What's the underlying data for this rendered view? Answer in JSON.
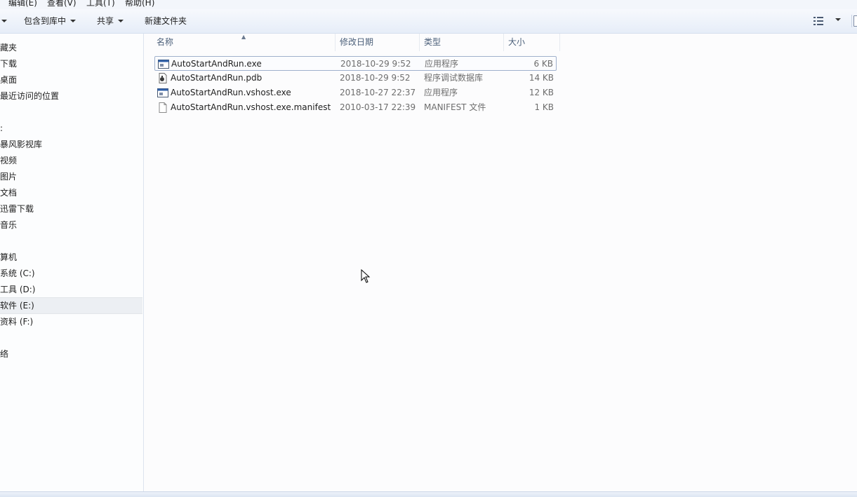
{
  "menu": {
    "edit": "编辑(E)",
    "view": "查看(V)",
    "tools": "工具(T)",
    "help": "帮助(H)"
  },
  "toolbar": {
    "include_in_library": "包含到库中",
    "share": "共享",
    "new_folder": "新建文件夹"
  },
  "nav": {
    "items": [
      "藏夹",
      "下载",
      "桌面",
      "最近访问的位置",
      "",
      "暴风影视库",
      "视频",
      "图片",
      "文档",
      "迅雷下载",
      "音乐",
      "算机",
      "系统 (C:)",
      "工具 (D:)",
      "软件 (E:)",
      "资料 (F:)",
      "络"
    ],
    "selected": "软件 (E:)"
  },
  "columns": {
    "name": "名称",
    "date": "修改日期",
    "type": "类型",
    "size": "大小"
  },
  "files": [
    {
      "name": "AutoStartAndRun.exe",
      "date": "2018-10-29 9:52",
      "type": "应用程序",
      "size": "6 KB",
      "icon": "exe-icon"
    },
    {
      "name": "AutoStartAndRun.pdb",
      "date": "2018-10-29 9:52",
      "type": "程序调试数据库",
      "size": "14 KB",
      "icon": "pdb-icon"
    },
    {
      "name": "AutoStartAndRun.vshost.exe",
      "date": "2018-10-27 22:37",
      "type": "应用程序",
      "size": "12 KB",
      "icon": "exe-icon"
    },
    {
      "name": "AutoStartAndRun.vshost.exe.manifest",
      "date": "2010-03-17 22:39",
      "type": "MANIFEST 文件",
      "size": "1 KB",
      "icon": "file-icon"
    }
  ],
  "colors": {
    "toolbar_top": "#f7f9fd",
    "toolbar_bottom": "#e6edf8",
    "header_text": "#4c607a",
    "selection_border": "#9fb0cc"
  }
}
